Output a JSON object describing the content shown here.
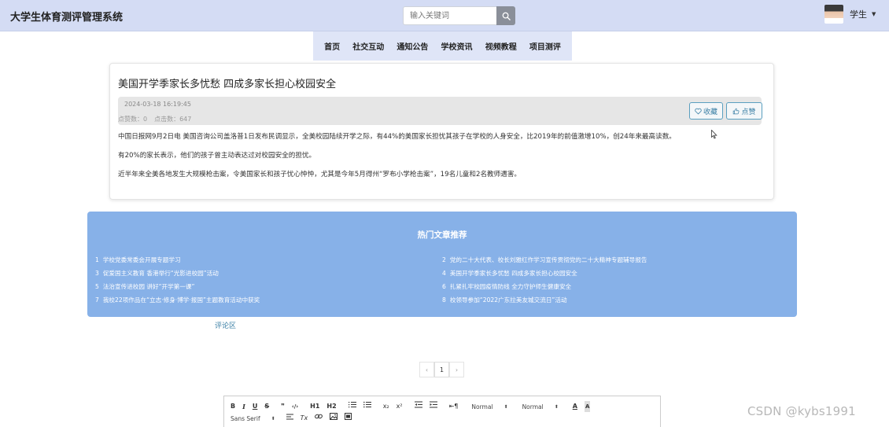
{
  "header": {
    "app_title": "大学生体育测评管理系统",
    "search_placeholder": "输入关键词",
    "user_name": "学生"
  },
  "nav": {
    "items": [
      "首页",
      "社交互动",
      "通知公告",
      "学校资讯",
      "视频教程",
      "项目测评"
    ]
  },
  "article": {
    "title": "美国开学季家长多忧愁 四成多家长担心校园安全",
    "time": "2024-03-18 16:19:45",
    "like_count_label": "点赞数：0",
    "view_count_label": "点击数：647",
    "fav_label": "收藏",
    "like_label": "点赞",
    "paragraphs": [
      "中国日报网9月2日电 美国咨询公司盖洛普1日发布民调显示，全美校园陆续开学之际，有44%的美国家长担忧其孩子在学校的人身安全，比2019年的前值激增10%，创24年来最高读数。",
      "有20%的家长表示，他们的孩子曾主动表达过对校园安全的担忧。",
      "近半年来全美各地发生大规模枪击案，令美国家长和孩子忧心忡忡，尤其是今年5月得州“罗布小学枪击案”，19名儿童和2名教师遇害。"
    ]
  },
  "hot": {
    "title": "热门文章推荐",
    "items": [
      {
        "num": "1",
        "text": "学校党委常委会开展专题学习"
      },
      {
        "num": "2",
        "text": "党的二十大代表、校长刘雅红作学习宣传贯彻党的二十大精神专题辅导报告"
      },
      {
        "num": "3",
        "text": "促爱国主义教育 香港举行“光影进校园”活动"
      },
      {
        "num": "4",
        "text": "美国开学季家长多忧愁 四成多家长担心校园安全"
      },
      {
        "num": "5",
        "text": "法治宣传进校园 讲好“开学第一课”"
      },
      {
        "num": "6",
        "text": "扎紧扎牢校园疫情防线 全力守护师生健康安全"
      },
      {
        "num": "7",
        "text": "我校22项作品在“立志·修身·博学·报国”主题教育活动中获奖"
      },
      {
        "num": "8",
        "text": "校领导参加“2022广东拉美友城交流日”活动"
      }
    ]
  },
  "comments": {
    "label": "评论区"
  },
  "pager": {
    "prev": "‹",
    "current": "1",
    "next": "›"
  },
  "editor": {
    "bold": "B",
    "italic": "I",
    "underline": "U",
    "strike": "S",
    "quote": "❞",
    "code": "‹/›",
    "h1": "H1",
    "h2": "H2",
    "sub": "x₂",
    "sup": "x²",
    "size_value": "Normal",
    "header_value": "Normal",
    "font_value": "Sans Serif",
    "clear": "Tx"
  },
  "watermark": "CSDN @kybs1991",
  "colors": {
    "header_bg": "#d4dcf4",
    "nav_bg": "#dfe5f7",
    "hot_bg": "#87b1e8",
    "accent": "#3a7fa5"
  }
}
